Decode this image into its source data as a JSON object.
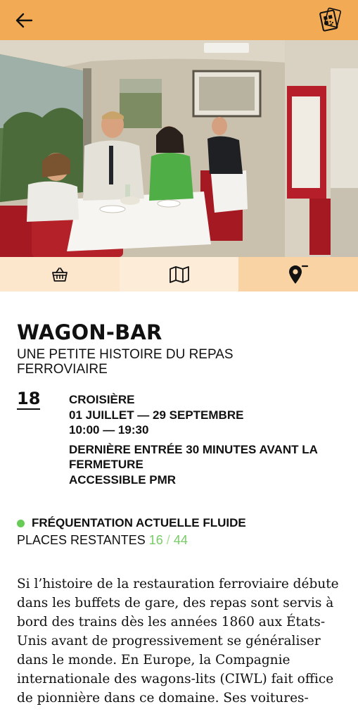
{
  "header": {
    "back_icon": "arrow-left-icon",
    "ticket_icon": "ticket-icon",
    "accent_color": "#f2ab54"
  },
  "tabs": [
    {
      "icon": "basket-icon"
    },
    {
      "icon": "map-icon"
    },
    {
      "icon": "location-pin-icon",
      "active": true
    }
  ],
  "event": {
    "title": "WAGON-BAR",
    "subtitle": "UNE PETITE HISTOIRE DU REPAS FERROVIAIRE",
    "number": "18",
    "category": "CROISIÈRE",
    "dates": "01 JUILLET — 29 SEPTEMBRE",
    "hours": "10:00 — 19:30",
    "last_entry": "DERNIÈRE ENTRÉE 30 MINUTES AVANT LA FERMETURE",
    "accessibility": "ACCESSIBLE PMR"
  },
  "status": {
    "attendance": "FRÉQUENTATION ACTUELLE FLUIDE",
    "places_label": "PLACES RESTANTES",
    "places_remaining": "16",
    "places_separator": "/",
    "places_total": "44",
    "status_color": "#66cc55"
  },
  "description": "Si l’histoire de la restauration ferroviaire débute dans les buffets de gare, des repas sont servis à bord des trains dès les années 1860 aux États-Unis avant de progressivement se généraliser dans le monde. En Europe, la Compagnie internationale des wagons-lits (CIWL) fait office de pionnière dans ce domaine. Ses voitures-"
}
